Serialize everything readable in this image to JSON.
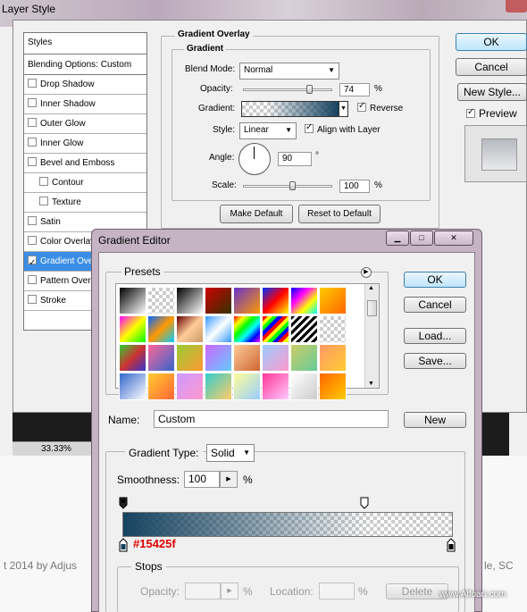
{
  "layer_style": {
    "title": "Layer Style",
    "styles_header": "Styles",
    "blending_options": "Blending Options: Custom",
    "items": [
      {
        "label": "Drop Shadow",
        "checked": false,
        "indent": false,
        "selected": false
      },
      {
        "label": "Inner Shadow",
        "checked": false,
        "indent": false,
        "selected": false
      },
      {
        "label": "Outer Glow",
        "checked": false,
        "indent": false,
        "selected": false
      },
      {
        "label": "Inner Glow",
        "checked": false,
        "indent": false,
        "selected": false
      },
      {
        "label": "Bevel and Emboss",
        "checked": false,
        "indent": false,
        "selected": false
      },
      {
        "label": "Contour",
        "checked": false,
        "indent": true,
        "selected": false
      },
      {
        "label": "Texture",
        "checked": false,
        "indent": true,
        "selected": false
      },
      {
        "label": "Satin",
        "checked": false,
        "indent": false,
        "selected": false
      },
      {
        "label": "Color Overlay",
        "checked": false,
        "indent": false,
        "selected": false
      },
      {
        "label": "Gradient Overlay",
        "checked": true,
        "indent": false,
        "selected": true
      },
      {
        "label": "Pattern Overlay",
        "checked": false,
        "indent": false,
        "selected": false
      },
      {
        "label": "Stroke",
        "checked": false,
        "indent": false,
        "selected": false
      }
    ],
    "overlay": {
      "group_title": "Gradient Overlay",
      "sub_title": "Gradient",
      "blend_mode_label": "Blend Mode:",
      "blend_mode_value": "Normal",
      "opacity_label": "Opacity:",
      "opacity_value": "74",
      "opacity_level": 0.74,
      "pct": "%",
      "gradient_label": "Gradient:",
      "reverse_label": "Reverse",
      "reverse_checked": true,
      "style_label": "Style:",
      "style_value": "Linear",
      "align_label": "Align with Layer",
      "align_checked": true,
      "angle_label": "Angle:",
      "angle_value": "90",
      "degree": "°",
      "scale_label": "Scale:",
      "scale_value": "100",
      "scale_level": 0.55,
      "make_default": "Make Default",
      "reset_default": "Reset to Default"
    },
    "buttons": {
      "ok": "OK",
      "cancel": "Cancel",
      "new_style": "New Style...",
      "preview": "Preview"
    },
    "preview_checked": true
  },
  "document": {
    "zoom": "33.33%",
    "credit_left": "t 2014 by Adjus",
    "credit_right": "le, SC"
  },
  "gradient_editor": {
    "title": "Gradient Editor",
    "presets_label": "Presets",
    "buttons": {
      "ok": "OK",
      "cancel": "Cancel",
      "load": "Load...",
      "save": "Save...",
      "new": "New",
      "delete": "Delete"
    },
    "name_label": "Name:",
    "name_value": "Custom",
    "gradient_type_label": "Gradient Type:",
    "gradient_type_value": "Solid",
    "smoothness_label": "Smoothness:",
    "smoothness_value": "100",
    "pct": "%",
    "color_stop_hex": "#15425f",
    "stops_label": "Stops",
    "opacity_label": "Opacity:",
    "location_label": "Location:",
    "base_color": "#15425f"
  },
  "watermark": "www.Alfoart.com"
}
